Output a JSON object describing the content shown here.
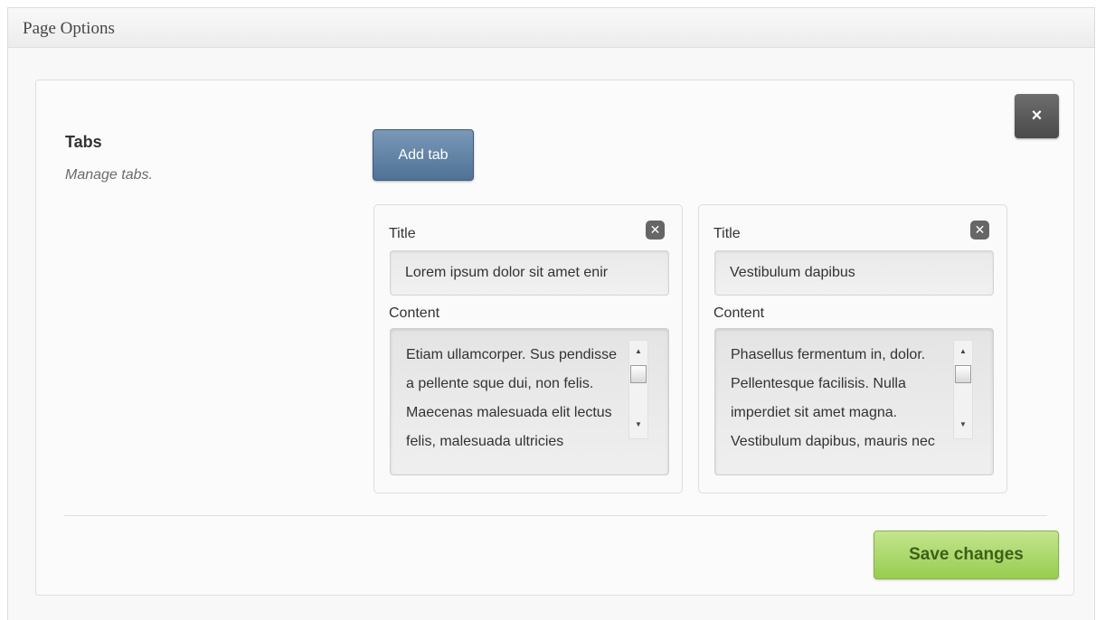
{
  "panel": {
    "title": "Page Options"
  },
  "section": {
    "title": "Tabs",
    "description": "Manage tabs."
  },
  "buttons": {
    "close_label": "×",
    "add_tab_label": "Add tab",
    "save_label": "Save changes"
  },
  "tabs": [
    {
      "title_label": "Title",
      "remove_label": "✕",
      "title_value": "Lorem ipsum dolor sit amet enir",
      "content_label": "Content",
      "content_value": "Etiam ullamcorper. Sus pendisse a pellente sque dui, non felis. Maecenas malesuada elit lectus felis, malesuada ultricies"
    },
    {
      "title_label": "Title",
      "remove_label": "✕",
      "title_value": "Vestibulum dapibus",
      "content_label": "Content",
      "content_value": "Phasellus fermentum in, dolor. Pellentesque facilisis. Nulla imperdiet sit amet magna. Vestibulum dapibus, mauris nec"
    }
  ],
  "scrollbar": {
    "up_arrow": "▲",
    "down_arrow": "▼"
  },
  "colors": {
    "add_tab_button": "#5f82a6",
    "save_button": "#a9d86a",
    "close_button": "#5a5a5a"
  },
  "icons": {
    "close": "close-icon",
    "remove_tab": "close-square-icon",
    "scroll_up": "arrow-up-icon",
    "scroll_down": "arrow-down-icon"
  }
}
